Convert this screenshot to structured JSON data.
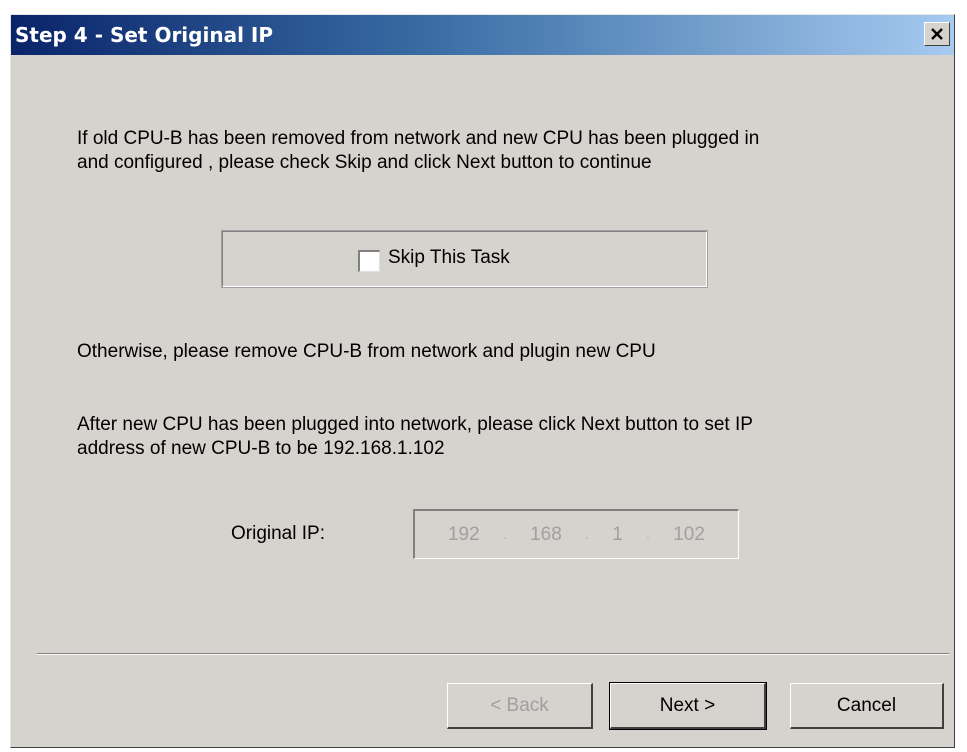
{
  "window": {
    "title": "Step 4 - Set Original IP",
    "close_glyph": "×"
  },
  "intro": {
    "line1": "If old CPU-B has been removed from network and new CPU has been plugged in",
    "line2": "and configured , please check Skip and click Next button to continue"
  },
  "skip": {
    "label": "Skip This Task",
    "checked": false
  },
  "otherwise_text": "Otherwise, please remove CPU-B from network and plugin new CPU",
  "after": {
    "line1": "After new CPU has been plugged into network, please click Next button to set IP",
    "line2": "address of new CPU-B to be 192.168.1.102"
  },
  "ip": {
    "label": "Original IP:",
    "octets": [
      "192",
      "168",
      "1",
      "102"
    ]
  },
  "buttons": {
    "back": "< Back",
    "next": "Next >",
    "cancel": "Cancel"
  },
  "icons": {
    "close": "close-icon"
  }
}
